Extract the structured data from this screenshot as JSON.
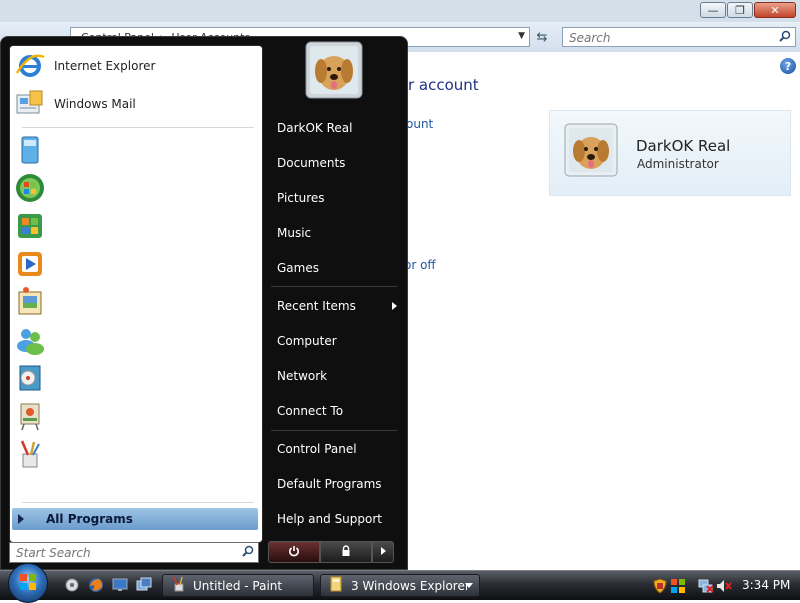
{
  "explorer": {
    "address_path": [
      "Control Panel",
      "User Accounts"
    ],
    "search_placeholder": "Search",
    "heading_fragment": "r account",
    "link_fragment_1": "ount",
    "link_fragment_2": "or off",
    "user_card": {
      "name": "DarkOK Real",
      "role": "Administrator"
    }
  },
  "start_menu": {
    "pinned": [
      {
        "label": "Internet Explorer",
        "icon": "internet-explorer-icon"
      },
      {
        "label": "Windows Mail",
        "icon": "windows-mail-icon"
      }
    ],
    "recent_program_icons": [
      "windows-sidebar-icon",
      "welcome-center-icon",
      "windows-media-center-icon",
      "windows-media-player-icon",
      "windows-photo-gallery-icon",
      "windows-meeting-space-icon",
      "windows-dvd-maker-icon",
      "windows-fax-and-scan-icon",
      "paint-icon"
    ],
    "all_programs_label": "All Programs",
    "search_placeholder": "Start Search",
    "right_items": {
      "user": "DarkOK Real",
      "documents": "Documents",
      "pictures": "Pictures",
      "music": "Music",
      "games": "Games",
      "recent_items": "Recent Items",
      "computer": "Computer",
      "network": "Network",
      "connect_to": "Connect To",
      "control_panel": "Control Panel",
      "default_programs": "Default Programs",
      "help_and_support": "Help and Support"
    }
  },
  "taskbar": {
    "quick_launch": [
      "show-desktop-icon",
      "firefox-icon",
      "monitor-icon",
      "switch-windows-icon"
    ],
    "tasks": [
      {
        "label": "Untitled - Paint",
        "icon": "paint-icon"
      },
      {
        "label": "3 Windows Explorer",
        "icon": "folder-icon"
      }
    ],
    "clock": "3:34 PM"
  },
  "colors": {
    "start_menu_bg": "#0f0f0f",
    "all_programs_highlight": "#6b9ccd",
    "link_blue": "#2057a3",
    "heading_blue": "#1e3287"
  }
}
